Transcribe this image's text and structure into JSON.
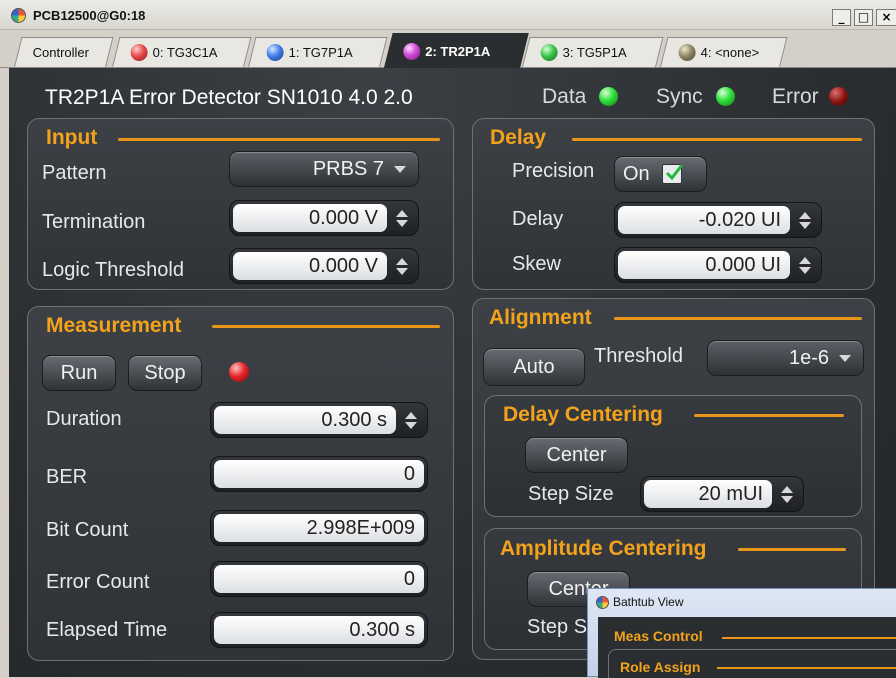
{
  "window": {
    "title": "PCB12500@G0:18",
    "controls": [
      "_",
      "□",
      "×"
    ]
  },
  "tabs": [
    {
      "label": "Controller",
      "led": null
    },
    {
      "label": "0: TG3C1A",
      "led": "#e84848"
    },
    {
      "label": "1: TG7P1A",
      "led": "#3e7ee8"
    },
    {
      "label": "2: TR2P1A",
      "led": "#d24ad6",
      "active": true
    },
    {
      "label": "3: TG5P1A",
      "led": "#39c54a"
    },
    {
      "label": "4: <none>",
      "led": "#8e8664"
    }
  ],
  "device_title": "TR2P1A Error Detector SN1010 4.0 2.0",
  "status": {
    "data": {
      "label": "Data",
      "color": "#2ee03a"
    },
    "sync": {
      "label": "Sync",
      "color": "#2ee03a"
    },
    "error": {
      "label": "Error",
      "color": "#8a1410"
    }
  },
  "input": {
    "title": "Input",
    "pattern_label": "Pattern",
    "pattern_value": "PRBS 7",
    "termination_label": "Termination",
    "termination_value": "0.000 V",
    "logic_label": "Logic Threshold",
    "logic_value": "0.000 V"
  },
  "delay": {
    "title": "Delay",
    "precision_label": "Precision",
    "precision_value": "On",
    "delay_label": "Delay",
    "delay_value": "-0.020 UI",
    "skew_label": "Skew",
    "skew_value": "0.000 UI"
  },
  "measurement": {
    "title": "Measurement",
    "run_label": "Run",
    "stop_label": "Stop",
    "indicator_color": "#e8262a",
    "duration_label": "Duration",
    "duration_value": "0.300 s",
    "ber_label": "BER",
    "ber_value": "0",
    "bitcount_label": "Bit Count",
    "bitcount_value": "2.998E+009",
    "errorcount_label": "Error Count",
    "errorcount_value": "0",
    "elapsed_label": "Elapsed Time",
    "elapsed_value": "0.300 s"
  },
  "alignment": {
    "title": "Alignment",
    "auto_label": "Auto",
    "threshold_label": "Threshold",
    "threshold_value": "1e-6"
  },
  "delay_centering": {
    "title": "Delay Centering",
    "center_label": "Center",
    "step_label": "Step Size",
    "step_value": "20 mUI"
  },
  "amplitude_centering": {
    "title": "Amplitude Centering",
    "center_label": "Center",
    "step_label": "Step S"
  },
  "bathtub": {
    "title": "Bathtub View",
    "meas_control": "Meas Control",
    "role_assign": "Role Assign"
  }
}
